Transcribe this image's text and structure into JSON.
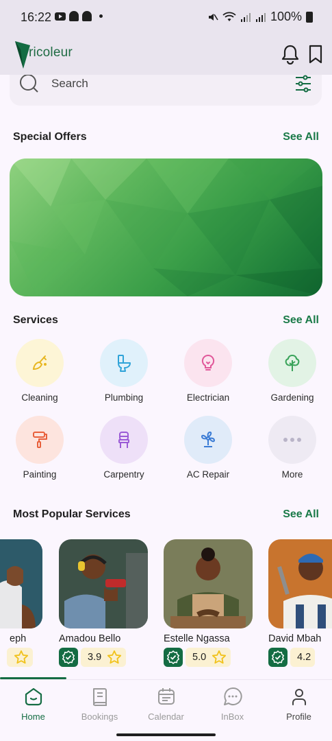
{
  "status_bar": {
    "time": "16:22",
    "battery": "100%"
  },
  "header": {
    "app_name": "ricoleur",
    "brand_color": "#146c43"
  },
  "search": {
    "placeholder": "Search"
  },
  "special_offers": {
    "title": "Special Offers",
    "see_all": "See All"
  },
  "services": {
    "title": "Services",
    "see_all": "See All",
    "items": [
      {
        "label": "Cleaning",
        "icon": "broom-icon",
        "bg": "#fdf5d6",
        "color": "#e7b621"
      },
      {
        "label": "Plumbing",
        "icon": "toilet-icon",
        "bg": "#e0f1fb",
        "color": "#2fa3d8"
      },
      {
        "label": "Electrician",
        "icon": "lightbulb-icon",
        "bg": "#fbe4ef",
        "color": "#e1589a"
      },
      {
        "label": "Gardening",
        "icon": "tree-icon",
        "bg": "#e2f3e5",
        "color": "#3aa35a"
      },
      {
        "label": "Painting",
        "icon": "paint-roller-icon",
        "bg": "#fde4de",
        "color": "#e8603c"
      },
      {
        "label": "Carpentry",
        "icon": "chair-icon",
        "bg": "#eee0f8",
        "color": "#9b5bd6"
      },
      {
        "label": "AC Repair",
        "icon": "fan-icon",
        "bg": "#e0ebf9",
        "color": "#3a7bd5"
      },
      {
        "label": "More",
        "icon": "more-dots-icon",
        "bg": "#eeeaf3",
        "color": "#b9b4c8"
      }
    ]
  },
  "popular": {
    "title": "Most Popular Services",
    "see_all": "See All",
    "pros": [
      {
        "name": "eph"
      },
      {
        "name": "Amadou Bello",
        "rating": "3.9"
      },
      {
        "name": "Estelle Ngassa",
        "rating": "5.0"
      },
      {
        "name": "David Mbah",
        "rating": "4.2"
      }
    ]
  },
  "nav": {
    "items": [
      {
        "label": "Home",
        "icon": "home-icon",
        "active": true
      },
      {
        "label": "Bookings",
        "icon": "book-icon"
      },
      {
        "label": "Calendar",
        "icon": "calendar-icon"
      },
      {
        "label": "InBox",
        "icon": "chat-icon"
      },
      {
        "label": "Profile",
        "icon": "profile-icon"
      }
    ]
  }
}
